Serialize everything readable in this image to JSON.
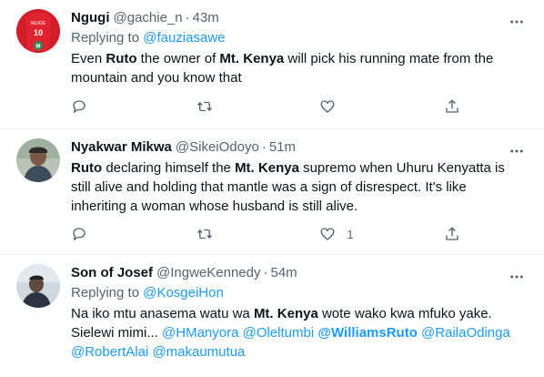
{
  "tweets": [
    {
      "display_name": "Ngugi",
      "handle": "@gachie_n",
      "separator": "·",
      "time": "43m",
      "replying_prefix": "Replying to",
      "replying_to": "@fauziasawe",
      "text": {
        "p1": "Even ",
        "b1": "Ruto",
        "p2": " the owner of ",
        "b2": "Mt. Kenya",
        "p3": " will pick his running mate from the mountain and you know that"
      },
      "avatar": {
        "jersey_name": "NGIGE",
        "jersey_number": "10",
        "badge": "M"
      },
      "actions": {
        "reply_count": "",
        "retweet_count": "",
        "like_count": ""
      }
    },
    {
      "display_name": "Nyakwar Mikwa",
      "handle": "@SikeiOdoyo",
      "separator": "·",
      "time": "51m",
      "text": {
        "b1": "Ruto",
        "p1": " declaring himself the ",
        "b2": "Mt. Kenya",
        "p2": " supremo when Uhuru Kenyatta is still alive and holding that mantle was a sign of disrespect. It's like inheriting a woman whose husband is still alive."
      },
      "actions": {
        "reply_count": "",
        "retweet_count": "",
        "like_count": "1"
      }
    },
    {
      "display_name": "Son of Josef",
      "handle": "@IngweKennedy",
      "separator": "·",
      "time": "54m",
      "replying_prefix": "Replying to",
      "replying_to": "@KosgeiHon",
      "text": {
        "p1": "Na iko mtu anasema watu wa ",
        "b1": "Mt. Kenya",
        "p2": " wote wako kwa mfuko yake. Sielewi mimi... ",
        "m1": "@HManyora",
        "m2": "@Oleltumbi",
        "m3": "@WilliamsRuto",
        "m4": "@RailaOdinga",
        "m5": "@RobertAlai",
        "m6": "@makaumutua"
      },
      "actions": {
        "reply_count": "",
        "retweet_count": "",
        "like_count": ""
      }
    }
  ],
  "colors": {
    "text": "#0f1419",
    "secondary": "#536471",
    "link": "#1d9bf0",
    "divider": "#eff3f4"
  },
  "icons": {
    "more": "more-dots-icon",
    "reply": "reply-icon",
    "retweet": "retweet-icon",
    "like": "heart-icon",
    "share": "share-icon"
  }
}
